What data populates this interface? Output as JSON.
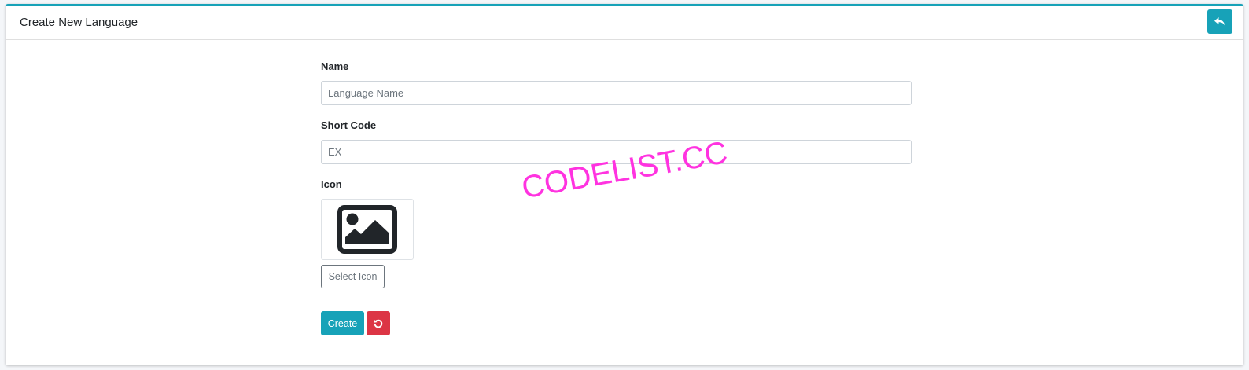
{
  "header": {
    "title": "Create New Language",
    "back_icon": "reply-icon"
  },
  "form": {
    "name": {
      "label": "Name",
      "placeholder": "Language Name",
      "value": ""
    },
    "short_code": {
      "label": "Short Code",
      "placeholder": "EX",
      "value": ""
    },
    "icon": {
      "label": "Icon",
      "preview_icon": "image-icon",
      "select_label": "Select Icon"
    },
    "create_label": "Create",
    "reset_icon": "undo-icon"
  },
  "watermark": "CODELIST.CC",
  "colors": {
    "accent": "#17a2b8",
    "danger": "#dc3545",
    "watermark": "#ff33e0"
  }
}
